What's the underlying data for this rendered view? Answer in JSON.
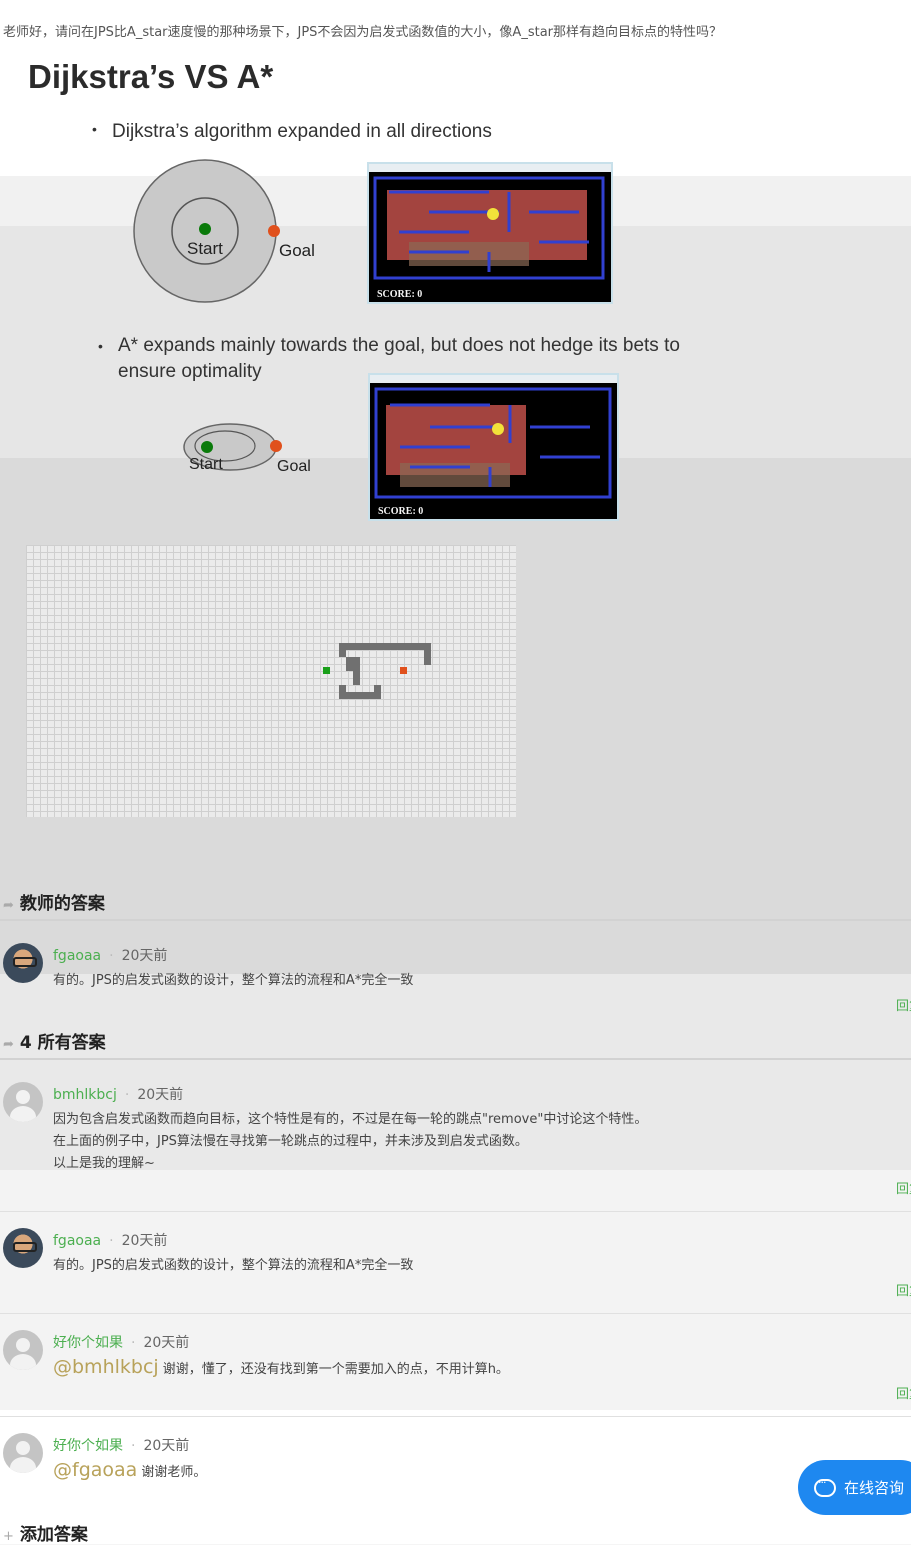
{
  "question": "老师好，请问在JPS比A_star速度慢的那种场景下，JPS不会因为启发式函数值的大小，像A_star那样有趋向目标点的特性吗？",
  "slide": {
    "title": "Dijkstra’s VS A*",
    "bullet1": "Dijkstra’s algorithm expanded in all directions",
    "bullet2_line1": "A* expands mainly towards the goal, but does not hedge its bets to",
    "bullet2_line2": "ensure optimality",
    "start_label": "Start",
    "goal_label": "Goal",
    "score_label": "SCORE:   0"
  },
  "teacher_section": {
    "title": "教师的答案",
    "answer": {
      "user": "fgaoaa",
      "time": "20天前",
      "text": "有的。JPS的启发式函数的设计，整个算法的流程和A*完全一致",
      "reply": "回复"
    }
  },
  "all_section": {
    "title": "4 所有答案",
    "answers": [
      {
        "user": "bmhlkbcj",
        "time": "20天前",
        "lines": [
          "因为包含启发式函数而趋向目标，这个特性是有的，不过是在每一轮的跳点\"remove\"中讨论这个特性。",
          "在上面的例子中，JPS算法慢在寻找第一轮跳点的过程中，并未涉及到启发式函数。",
          "以上是我的理解~"
        ],
        "reply": "回复"
      },
      {
        "user": "fgaoaa",
        "time": "20天前",
        "text": "有的。JPS的启发式函数的设计，整个算法的流程和A*完全一致",
        "reply": "回复"
      },
      {
        "user": "好你个如果",
        "time": "20天前",
        "mention": "@bmhlkbcj",
        "text": "谢谢，懂了，还没有找到第一个需要加入的点，不用计算h。",
        "reply": "回复"
      },
      {
        "user": "好你个如果",
        "time": "20天前",
        "mention": "@fgaoaa",
        "text": "谢谢老师。"
      }
    ]
  },
  "add_answer": "添加答案",
  "chat_button": "在线咨询"
}
